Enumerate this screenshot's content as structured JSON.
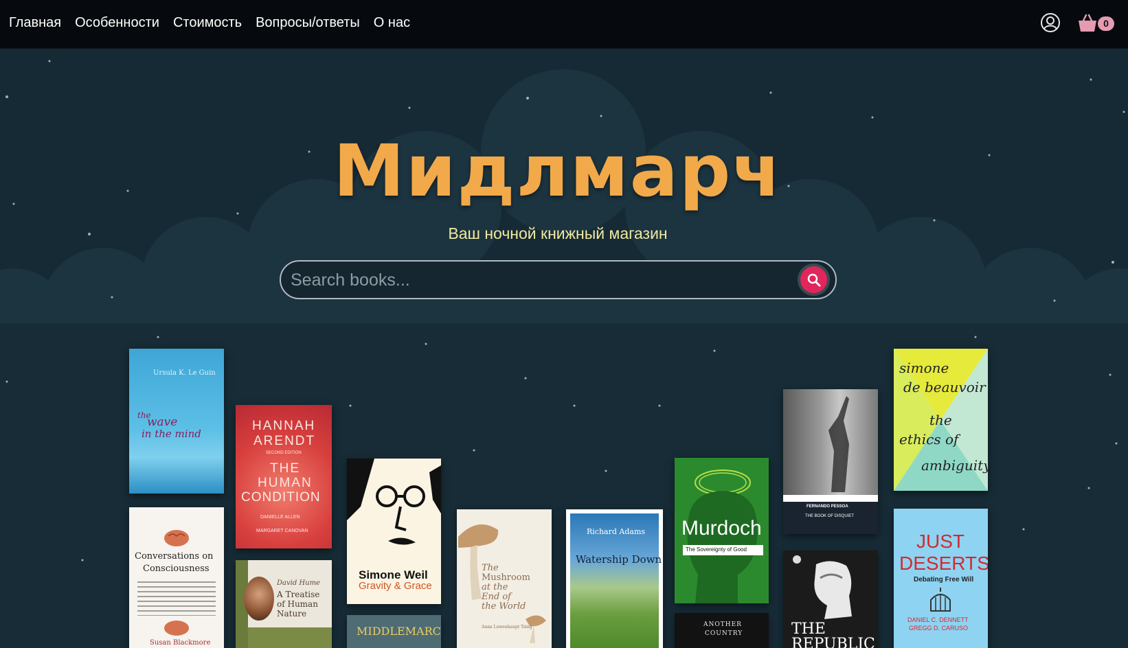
{
  "nav": {
    "items": [
      {
        "label": "Главная"
      },
      {
        "label": "Особенности"
      },
      {
        "label": "Стоимость"
      },
      {
        "label": "Вопросы/ответы"
      },
      {
        "label": "О нас"
      }
    ],
    "user_icon": "user-circle-icon",
    "cart_icon": "basket-icon",
    "cart_count": "0"
  },
  "hero": {
    "title": "Мидлмарч",
    "tagline": "Ваш ночной книжный магазин"
  },
  "search": {
    "placeholder": "Search books...",
    "button_icon": "search-icon"
  },
  "colors": {
    "background": "#162a35",
    "navbar": "#060a0e",
    "brand": "#f2a94a",
    "tagline": "#f1e9a1",
    "search_button": "#e0265c",
    "cart_badge": "#e69bb2"
  },
  "books": {
    "wave": {
      "author": "Ursula K. Le Guin",
      "title_1": "the",
      "title_2": "wave",
      "title_3": "in the mind"
    },
    "conversations": {
      "title_1": "Conversations on",
      "title_2": "Consciousness",
      "author": "Susan Blackmore"
    },
    "arendt": {
      "author_1": "HANNAH",
      "author_2": "ARENDT",
      "edition": "SECOND EDITION",
      "title_1": "THE",
      "title_2": "HUMAN",
      "title_3": "CONDITION",
      "foreword": "DANIELLE ALLEN",
      "intro": "MARGARET CANOVAN"
    },
    "hume": {
      "author": "David Hume",
      "title_1": "A Treatise",
      "title_2": "of Human",
      "title_3": "Nature"
    },
    "weil": {
      "author": "Simone Weil",
      "title": "Gravity & Grace"
    },
    "middlemarch": {
      "title": "MIDDLEMARCH"
    },
    "mushroom": {
      "title_1": "The",
      "title_2": "Mushroom",
      "title_3": "at the",
      "title_4": "End of",
      "title_5": "the World",
      "author": "Anna Lowenhaupt Tsing"
    },
    "watership": {
      "author": "Richard Adams",
      "title": "Watership Down"
    },
    "murdoch": {
      "author": "Murdoch",
      "title": "The Sovereignty of Good"
    },
    "another_country": {
      "title_1": "ANOTHER",
      "title_2": "COUNTRY"
    },
    "pessoa": {
      "author": "FERNANDO PESSOA",
      "title": "THE BOOK OF DISQUIET"
    },
    "republic": {
      "title_1": "THE",
      "title_2": "REPUBLIC"
    },
    "beauvoir": {
      "author_1": "simone",
      "author_2": "de beauvoir",
      "title_1": "the",
      "title_2": "ethics of",
      "title_3": "ambiguity"
    },
    "deserts": {
      "title_1": "JUST",
      "title_2": "DESERTS",
      "subtitle": "Debating Free Will",
      "author_1": "DANIEL C. DENNETT",
      "author_2": "GREGG D. CARUSO"
    }
  }
}
